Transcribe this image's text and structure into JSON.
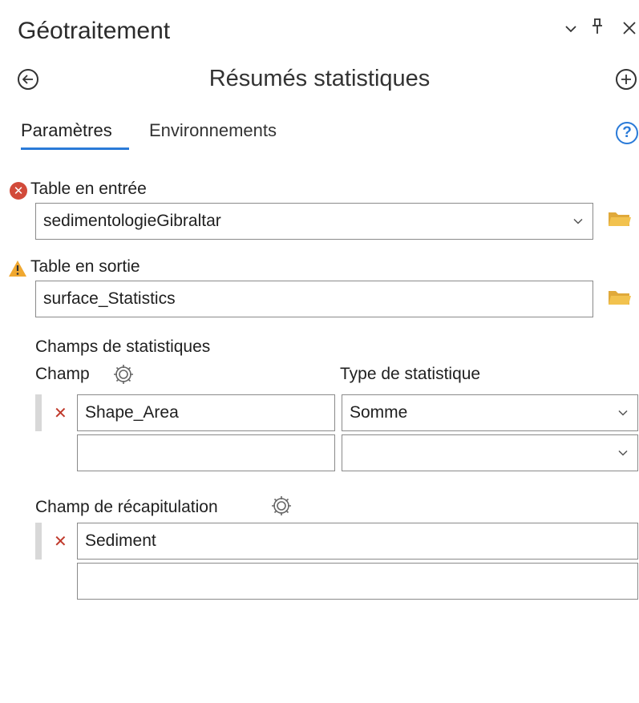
{
  "header": {
    "title": "Géotraitement",
    "tool_title": "Résumés statistiques"
  },
  "tabs": [
    {
      "label": "Paramètres",
      "active": true
    },
    {
      "label": "Environnements",
      "active": false
    }
  ],
  "params": {
    "input_table": {
      "label": "Table en entrée",
      "value": "sedimentologieGibraltar",
      "status": "error"
    },
    "output_table": {
      "label": "Table en sortie",
      "value": "surface_Statistics",
      "status": "warning"
    },
    "statistics_fields": {
      "label": "Champs de statistiques",
      "col_field": "Champ",
      "col_type": "Type de statistique",
      "rows": [
        {
          "field": "Shape_Area",
          "type": "Somme"
        },
        {
          "field": "",
          "type": ""
        }
      ]
    },
    "case_field": {
      "label": "Champ de récapitulation",
      "rows": [
        {
          "field": "Sediment"
        },
        {
          "field": ""
        }
      ]
    }
  },
  "colors": {
    "accent": "#2a7ad8",
    "error": "#d24a3a",
    "warning": "#f0a830",
    "folder": "#f2c24e"
  }
}
